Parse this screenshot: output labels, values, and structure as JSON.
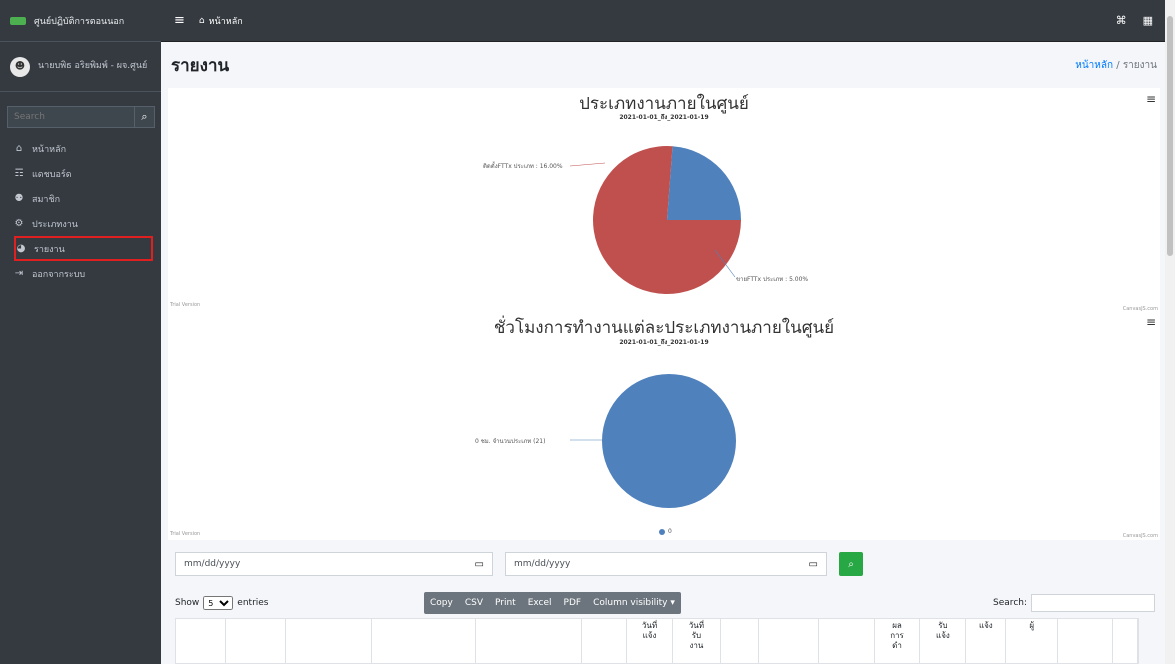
{
  "brand": {
    "name": "ศูนย์ปฏิบัติการตอนนอก"
  },
  "user": {
    "name": "นายบพิธ อริยพิมพ์ - ผจ.ศูนย์"
  },
  "sidebar": {
    "search_placeholder": "Search",
    "items": [
      {
        "label": "หน้าหลัก",
        "icon": "home-icon"
      },
      {
        "label": "แดชบอร์ด",
        "icon": "chart-area-icon"
      },
      {
        "label": "สมาชิก",
        "icon": "users-icon"
      },
      {
        "label": "ประเภทงาน",
        "icon": "cogs-icon"
      },
      {
        "label": "รายงาน",
        "icon": "chart-pie-icon"
      },
      {
        "label": "ออกจากระบบ",
        "icon": "sign-out-icon"
      }
    ]
  },
  "topbar": {
    "home_label": "หน้าหลัก"
  },
  "header": {
    "title": "รายงาน",
    "breadcrumb_home": "หน้าหลัก",
    "breadcrumb_sep": "/",
    "breadcrumb_current": "รายงาน"
  },
  "chart1": {
    "title": "ประเภทงานภายในศูนย์",
    "subtitle": "2021-01-01_ถึง_2021-01-19",
    "label_a": "ติดตั้งFTTx ประเภท : 16.00%",
    "label_b": "ขายFTTx ประเภท : 5.00%",
    "trial": "Trial Version",
    "credit": "CanvasJS.com"
  },
  "chart2": {
    "title": "ชั่วโมงการทำงานแต่ละประเภทงานภายในศูนย์",
    "subtitle": "2021-01-01_ถึง_2021-01-19",
    "label_a": "0 ชม. จำนวนประเภท (21)",
    "legend": "0",
    "trial": "Trial Version",
    "credit": "CanvasJS.com"
  },
  "chart_data": [
    {
      "type": "pie",
      "title": "ประเภทงานภายในศูนย์",
      "subtitle": "2021-01-01_ถึง_2021-01-19",
      "slices": [
        {
          "label": "ติดตั้งFTTx ประเภท",
          "value": 16.0,
          "color": "#c0504e"
        },
        {
          "label": "ขายFTTx ประเภท",
          "value": 5.0,
          "color": "#4f81bc"
        }
      ]
    },
    {
      "type": "pie",
      "title": "ชั่วโมงการทำงานแต่ละประเภทงานภายในศูนย์",
      "subtitle": "2021-01-01_ถึง_2021-01-19",
      "slices": [
        {
          "label": "0 ชม. จำนวนประเภท (21)",
          "value": 21,
          "color": "#4f81bc"
        }
      ],
      "legend": [
        "0"
      ]
    }
  ],
  "filters": {
    "date_placeholder_1": "mm/dd/yyyy",
    "date_placeholder_2": "mm/dd/yyyy"
  },
  "table_controls": {
    "show_label": "Show",
    "entries_label": "entries",
    "page_size": "5",
    "buttons": [
      "Copy",
      "CSV",
      "Print",
      "Excel",
      "PDF",
      "Column visibility ▾"
    ],
    "search_label": "Search:"
  },
  "table": {
    "headers": [
      "",
      "",
      "",
      "",
      "",
      "",
      "วันที่ แจ้ง",
      "วันที่ รับ งาน",
      "",
      "",
      "",
      "ผล การ ดำ",
      "รับ แจ้ง",
      "แจ้ง",
      "ผู้",
      "",
      ""
    ]
  },
  "colors": {
    "sidebar": "#343a40",
    "pie_red": "#c0504e",
    "pie_blue": "#4f81bc",
    "accent": "#28a745",
    "highlight": "#e02020"
  }
}
